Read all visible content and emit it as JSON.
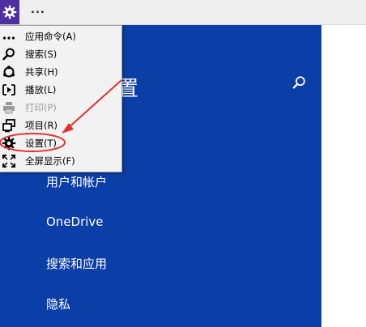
{
  "titlebar": {
    "overflow_label": "...",
    "icon": "gear-icon",
    "accent": "#4f2f9f"
  },
  "menu": {
    "items": [
      {
        "label": "应用命令(A)",
        "icon": "more-icon",
        "disabled": false
      },
      {
        "label": "搜索(S)",
        "icon": "search-icon",
        "disabled": false
      },
      {
        "label": "共享(H)",
        "icon": "share-icon",
        "disabled": false
      },
      {
        "label": "播放(L)",
        "icon": "play-icon",
        "disabled": false
      },
      {
        "label": "打印(P)",
        "icon": "print-icon",
        "disabled": true
      },
      {
        "label": "项目(R)",
        "icon": "project-icon",
        "disabled": false
      },
      {
        "label": "设置(T)",
        "icon": "gear-icon",
        "disabled": false
      },
      {
        "label": "全屏显示(F)",
        "icon": "fullscreen-icon",
        "disabled": false
      }
    ]
  },
  "panel": {
    "title_fragment": "置",
    "background": "#0b3ea6",
    "settings_items": [
      "用户和帐户",
      "OneDrive",
      "搜索和应用",
      "隐私"
    ]
  },
  "annotation": {
    "color": "#e03030"
  }
}
